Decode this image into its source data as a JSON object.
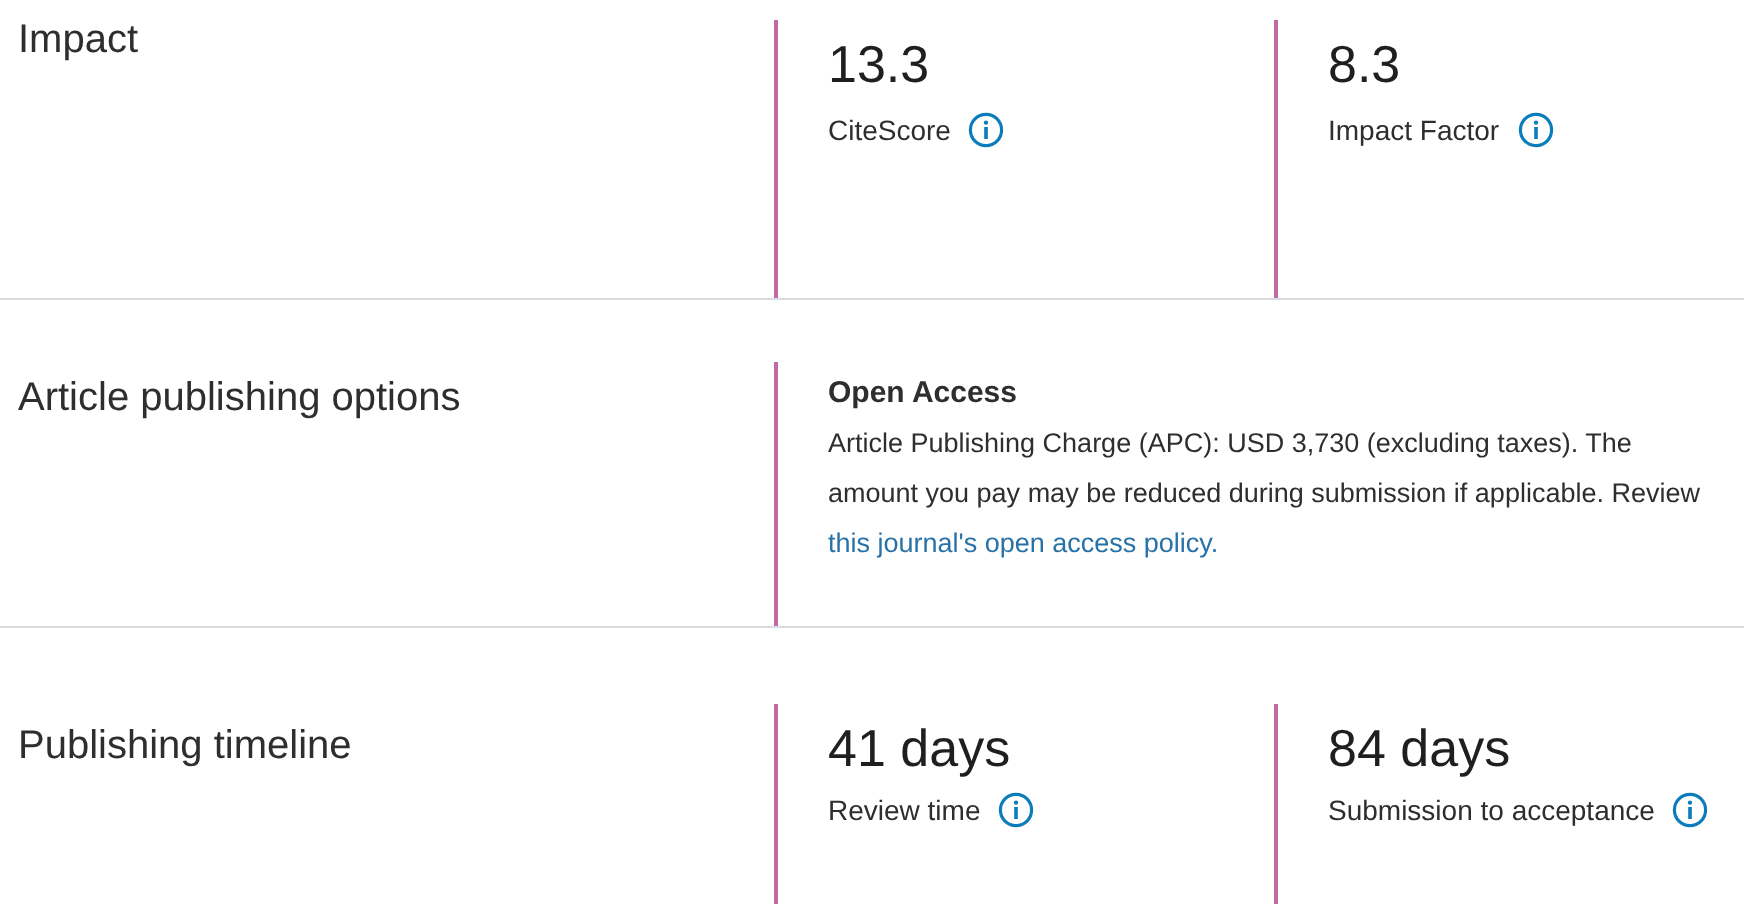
{
  "sections": [
    {
      "kind": "metrics",
      "title": "Impact",
      "metrics": [
        {
          "value": "13.3",
          "label": "CiteScore"
        },
        {
          "value": "8.3",
          "label": "Impact Factor"
        }
      ]
    },
    {
      "kind": "text",
      "title": "Article publishing options",
      "heading": "Open Access",
      "description": "Article Publishing Charge (APC): USD 3,730 (excluding taxes). The amount you pay may be reduced during submission if applicable. Review",
      "link": "this journal's open access policy."
    },
    {
      "kind": "metrics",
      "title": "Publishing timeline",
      "metrics": [
        {
          "value": "41 days",
          "label": "Review time"
        },
        {
          "value": "84 days",
          "label": "Submission to acceptance"
        }
      ]
    }
  ]
}
